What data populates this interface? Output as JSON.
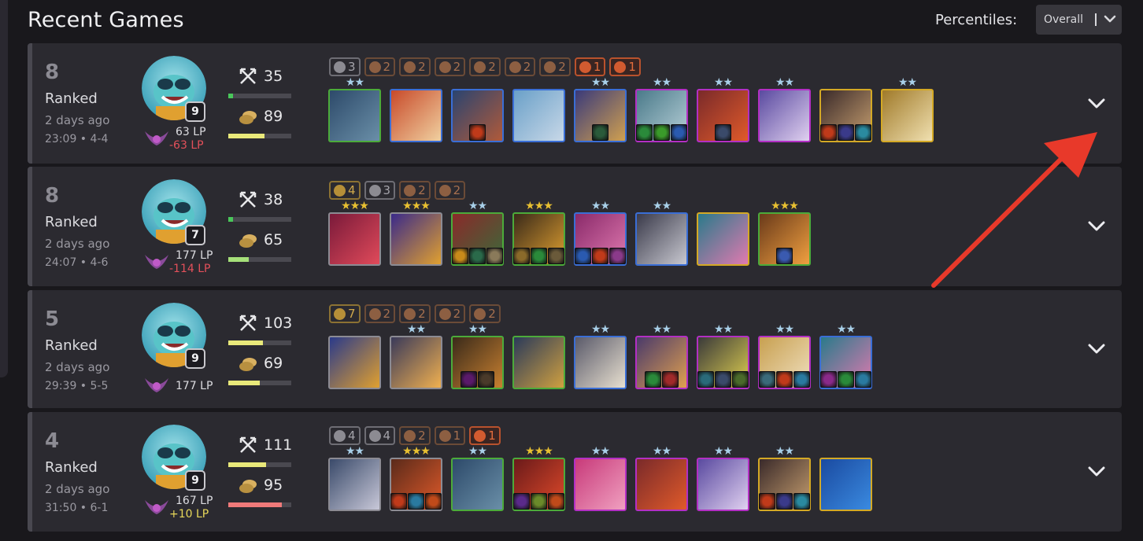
{
  "header": {
    "title": "Recent Games",
    "percentiles_label": "Percentiles:",
    "percentiles_value": "Overall"
  },
  "games": [
    {
      "placement": "8",
      "mode": "Ranked",
      "time_ago": "2 days ago",
      "duration": "23:09 • 4-4",
      "level": "9",
      "lp": "63 LP",
      "lp_delta": "-63 LP",
      "damage": "35",
      "damage_fill": 0.08,
      "damage_color": "#49c75a",
      "gold": "89",
      "gold_fill": 0.58,
      "gold_color": "#e9e97a",
      "traits": [
        {
          "count": "3",
          "tier": "silver"
        },
        {
          "count": "2",
          "tier": "bronze"
        },
        {
          "count": "2",
          "tier": "bronze"
        },
        {
          "count": "2",
          "tier": "bronze"
        },
        {
          "count": "2",
          "tier": "bronze"
        },
        {
          "count": "2",
          "tier": "bronze"
        },
        {
          "count": "2",
          "tier": "bronze"
        },
        {
          "count": "1",
          "tier": "orange"
        },
        {
          "count": "1",
          "tier": "orange"
        }
      ],
      "units": [
        {
          "stars": 2,
          "tier": "green",
          "bg": [
            "#2d4a6a",
            "#6a8fa8"
          ],
          "items": []
        },
        {
          "stars": 0,
          "tier": "blue",
          "bg": [
            "#c84a2a",
            "#f0d0a0"
          ],
          "items": []
        },
        {
          "stars": 0,
          "tier": "blue",
          "bg": [
            "#2a4470",
            "#b05a3a"
          ],
          "items": [
            "#c03a1a"
          ]
        },
        {
          "stars": 0,
          "tier": "blue",
          "bg": [
            "#6aa0c8",
            "#c8d8e8"
          ],
          "items": []
        },
        {
          "stars": 2,
          "tier": "blue",
          "bg": [
            "#3a3a7a",
            "#d0a050"
          ],
          "items": [
            "#2a5a3a"
          ]
        },
        {
          "stars": 2,
          "tier": "purple",
          "bg": [
            "#4a7a8a",
            "#b8d0d8"
          ],
          "items": [
            "#2a8a3a",
            "#3a9a2a",
            "#2a5ab0"
          ]
        },
        {
          "stars": 2,
          "tier": "purple",
          "bg": [
            "#7a2a2a",
            "#e05a2a"
          ],
          "items": [
            "#3a4a6a"
          ]
        },
        {
          "stars": 2,
          "tier": "purple",
          "bg": [
            "#5a4aa0",
            "#e0d0f0"
          ],
          "items": []
        },
        {
          "stars": 0,
          "tier": "gold",
          "bg": [
            "#3a2a2a",
            "#c8a070"
          ],
          "items": [
            "#c03a1a",
            "#3a3a8a",
            "#2a8aa0"
          ]
        },
        {
          "stars": 2,
          "tier": "gold",
          "bg": [
            "#a07a2a",
            "#f0e0b0"
          ],
          "items": []
        }
      ]
    },
    {
      "placement": "8",
      "mode": "Ranked",
      "time_ago": "2 days ago",
      "duration": "24:07 • 4-6",
      "level": "7",
      "lp": "177 LP",
      "lp_delta": "-114 LP",
      "damage": "38",
      "damage_fill": 0.08,
      "damage_color": "#49c75a",
      "gold": "65",
      "gold_fill": 0.33,
      "gold_color": "#a6e07a",
      "traits": [
        {
          "count": "4",
          "tier": "gold"
        },
        {
          "count": "3",
          "tier": "silver"
        },
        {
          "count": "2",
          "tier": "bronze"
        },
        {
          "count": "2",
          "tier": "bronze"
        }
      ],
      "units": [
        {
          "stars": 3,
          "tier": "gray",
          "bg": [
            "#7a1a3a",
            "#e04a5a"
          ],
          "items": []
        },
        {
          "stars": 3,
          "tier": "gray",
          "bg": [
            "#3a2a8a",
            "#e0a030"
          ],
          "items": []
        },
        {
          "stars": 2,
          "tier": "green",
          "bg": [
            "#8a2a2a",
            "#3a6a3a"
          ],
          "items": [
            "#c88a1a",
            "#2a6a4a",
            "#8a7a5a"
          ]
        },
        {
          "stars": 3,
          "tier": "green",
          "bg": [
            "#3a2a1a",
            "#e0a030"
          ],
          "items": [
            "#8a6a2a",
            "#2a8a3a",
            "#6a5a3a"
          ]
        },
        {
          "stars": 2,
          "tier": "blue",
          "bg": [
            "#8a2a6a",
            "#e07ab0"
          ],
          "items": [
            "#2a5ab0",
            "#c03a1a",
            "#8a3a8a"
          ]
        },
        {
          "stars": 2,
          "tier": "blue",
          "bg": [
            "#3a3a4a",
            "#c8c8d0"
          ],
          "items": []
        },
        {
          "stars": 0,
          "tier": "gold",
          "bg": [
            "#2a7a8a",
            "#e07ab0"
          ],
          "items": []
        },
        {
          "stars": 3,
          "tier": "green",
          "bg": [
            "#6a3a1a",
            "#f0a040"
          ],
          "items": [
            "#3a5ab0"
          ]
        }
      ]
    },
    {
      "placement": "5",
      "mode": "Ranked",
      "time_ago": "2 days ago",
      "duration": "29:39 • 5-5",
      "level": "9",
      "lp": "177 LP",
      "lp_delta": "",
      "damage": "103",
      "damage_fill": 0.55,
      "damage_color": "#e9e97a",
      "gold": "69",
      "gold_fill": 0.5,
      "gold_color": "#e9e97a",
      "traits": [
        {
          "count": "7",
          "tier": "gold"
        },
        {
          "count": "2",
          "tier": "bronze"
        },
        {
          "count": "2",
          "tier": "bronze"
        },
        {
          "count": "2",
          "tier": "bronze"
        },
        {
          "count": "2",
          "tier": "bronze"
        }
      ],
      "units": [
        {
          "stars": 0,
          "tier": "gray",
          "bg": [
            "#2a3a8a",
            "#e0a030"
          ],
          "items": []
        },
        {
          "stars": 2,
          "tier": "gray",
          "bg": [
            "#3a3a5a",
            "#f0b050"
          ],
          "items": []
        },
        {
          "stars": 2,
          "tier": "green",
          "bg": [
            "#3a2a1a",
            "#c88030"
          ],
          "items": [
            "#5a1a6a",
            "#4a3a2a"
          ]
        },
        {
          "stars": 0,
          "tier": "green",
          "bg": [
            "#2a3a5a",
            "#d0a040"
          ],
          "items": []
        },
        {
          "stars": 2,
          "tier": "blue",
          "bg": [
            "#5a5a6a",
            "#e8e0d0"
          ],
          "items": []
        },
        {
          "stars": 2,
          "tier": "purple",
          "bg": [
            "#4a3a6a",
            "#e0a050"
          ],
          "items": [
            "#2a8a3a",
            "#a02a2a"
          ]
        },
        {
          "stars": 2,
          "tier": "purple",
          "bg": [
            "#3a3a3a",
            "#e0d050"
          ],
          "items": [
            "#2a6a7a",
            "#3a4a6a",
            "#4a6a2a"
          ]
        },
        {
          "stars": 2,
          "tier": "purple",
          "bg": [
            "#c8a050",
            "#f0e0c0"
          ],
          "items": [
            "#3a6a7a",
            "#c03a1a",
            "#2a7aa0"
          ]
        },
        {
          "stars": 2,
          "tier": "blue",
          "bg": [
            "#2a7a8a",
            "#e07ab0"
          ],
          "items": [
            "#8a2a8a",
            "#2a8a3a",
            "#2a7aa0"
          ]
        }
      ]
    },
    {
      "placement": "4",
      "mode": "Ranked",
      "time_ago": "2 days ago",
      "duration": "31:50 • 6-1",
      "level": "9",
      "lp": "167 LP",
      "lp_delta": "+10 LP",
      "damage": "111",
      "damage_fill": 0.6,
      "damage_color": "#e9e97a",
      "gold": "95",
      "gold_fill": 0.85,
      "gold_color": "#f07a7a",
      "traits": [
        {
          "count": "4",
          "tier": "silver"
        },
        {
          "count": "4",
          "tier": "silver"
        },
        {
          "count": "2",
          "tier": "bronze"
        },
        {
          "count": "1",
          "tier": "bronze"
        },
        {
          "count": "1",
          "tier": "orange"
        }
      ],
      "units": [
        {
          "stars": 2,
          "tier": "gray",
          "bg": [
            "#3a4a6a",
            "#c8c8d8"
          ],
          "items": []
        },
        {
          "stars": 3,
          "tier": "gray",
          "bg": [
            "#5a2a1a",
            "#e05a2a"
          ],
          "items": [
            "#c03a1a",
            "#2a7aa0",
            "#c04a1a"
          ]
        },
        {
          "stars": 2,
          "tier": "green",
          "bg": [
            "#2d4a6a",
            "#6a8fa8"
          ],
          "items": []
        },
        {
          "stars": 3,
          "tier": "green",
          "bg": [
            "#6a1a1a",
            "#e04a2a"
          ],
          "items": [
            "#5a2a8a",
            "#6a8a2a",
            "#c04a1a"
          ]
        },
        {
          "stars": 2,
          "tier": "purple",
          "bg": [
            "#c83a7a",
            "#f0a0c0"
          ],
          "items": []
        },
        {
          "stars": 2,
          "tier": "purple",
          "bg": [
            "#7a2a2a",
            "#e05a2a"
          ],
          "items": []
        },
        {
          "stars": 2,
          "tier": "purple",
          "bg": [
            "#5a4aa0",
            "#e0d0f0"
          ],
          "items": []
        },
        {
          "stars": 2,
          "tier": "gold",
          "bg": [
            "#3a2a2a",
            "#c8a070"
          ],
          "items": [
            "#c03a1a",
            "#3a3a8a",
            "#2a8aa0"
          ]
        },
        {
          "stars": 0,
          "tier": "gold",
          "bg": [
            "#1a4aa0",
            "#3a8ae0"
          ],
          "items": []
        }
      ]
    }
  ]
}
